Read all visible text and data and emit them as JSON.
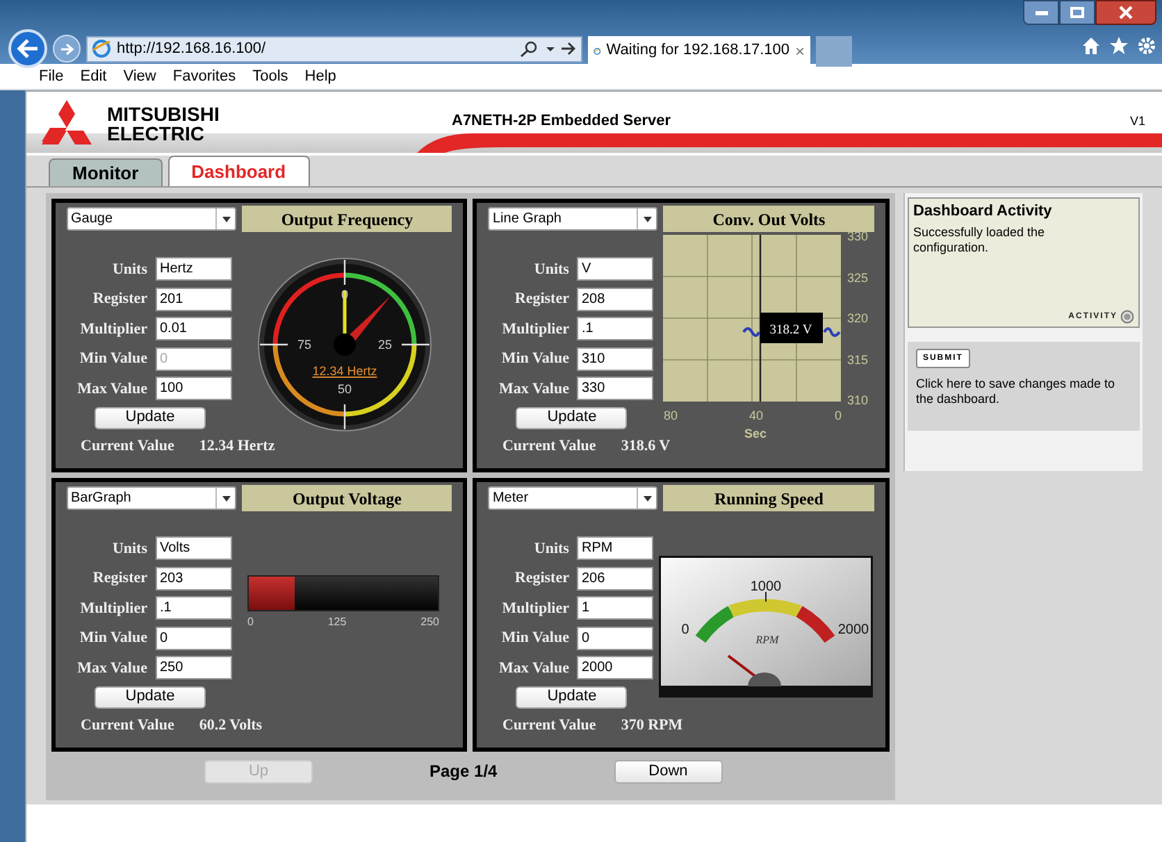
{
  "browser": {
    "address": "http://192.168.16.100/",
    "tab_title": "Waiting for 192.168.17.100",
    "tab_close": "×"
  },
  "menu": [
    "File",
    "Edit",
    "View",
    "Favorites",
    "Tools",
    "Help"
  ],
  "header": {
    "brand_line1": "MITSUBISHI",
    "brand_line2": "ELECTRIC",
    "title": "A7NETH-2P Embedded Server",
    "version": "V1"
  },
  "tabs": [
    {
      "label": "Monitor",
      "selected": false
    },
    {
      "label": "Dashboard",
      "selected": true
    }
  ],
  "widgets": [
    {
      "kind": "gauge",
      "display_type": "Gauge",
      "title": "Output Frequency",
      "fields": [
        {
          "label": "Units",
          "value": "Hertz",
          "disabled": false
        },
        {
          "label": "Register",
          "value": "201",
          "disabled": false
        },
        {
          "label": "Multiplier",
          "value": "0.01",
          "disabled": false
        },
        {
          "label": "Min Value",
          "value": "0",
          "disabled": true
        },
        {
          "label": "Max Value",
          "value": "100",
          "disabled": false
        }
      ],
      "update_button": "Update",
      "current_value_label": "Current Value",
      "current_value": "12.34 Hertz",
      "scale_labels": [
        "0",
        "25",
        "50",
        "75"
      ],
      "readout": "12.34 Hertz"
    },
    {
      "kind": "line",
      "display_type": "Line Graph",
      "title": "Conv. Out Volts",
      "fields": [
        {
          "label": "Units",
          "value": "V",
          "disabled": false
        },
        {
          "label": "Register",
          "value": "208",
          "disabled": false
        },
        {
          "label": "Multiplier",
          "value": ".1",
          "disabled": false
        },
        {
          "label": "Min Value",
          "value": "310",
          "disabled": false
        },
        {
          "label": "Max Value",
          "value": "330",
          "disabled": false
        }
      ],
      "update_button": "Update",
      "current_value_label": "Current Value",
      "current_value": "318.6 V",
      "y_ticks": [
        "330",
        "325",
        "320",
        "315",
        "310"
      ],
      "x_ticks": [
        "80",
        "40",
        "0"
      ],
      "x_label": "Sec",
      "tooltip": "318.2 V"
    },
    {
      "kind": "bar",
      "display_type": "BarGraph",
      "title": "Output Voltage",
      "fields": [
        {
          "label": "Units",
          "value": "Volts",
          "disabled": false
        },
        {
          "label": "Register",
          "value": "203",
          "disabled": false
        },
        {
          "label": "Multiplier",
          "value": ".1",
          "disabled": false
        },
        {
          "label": "Min Value",
          "value": "0",
          "disabled": false
        },
        {
          "label": "Max Value",
          "value": "250",
          "disabled": false
        }
      ],
      "update_button": "Update",
      "current_value_label": "Current Value",
      "current_value": "60.2 Volts",
      "scale_labels": [
        "0",
        "125",
        "250"
      ],
      "level": 0.24
    },
    {
      "kind": "meter",
      "display_type": "Meter",
      "title": "Running Speed",
      "fields": [
        {
          "label": "Units",
          "value": "RPM",
          "disabled": false
        },
        {
          "label": "Register",
          "value": "206",
          "disabled": false
        },
        {
          "label": "Multiplier",
          "value": "1",
          "disabled": false
        },
        {
          "label": "Min Value",
          "value": "0",
          "disabled": false
        },
        {
          "label": "Max Value",
          "value": "2000",
          "disabled": false
        }
      ],
      "update_button": "Update",
      "current_value_label": "Current Value",
      "current_value": "370 RPM",
      "scale_labels": [
        "0",
        "1000",
        "2000"
      ],
      "unit_label": "RPM"
    }
  ],
  "pager": {
    "up": {
      "label": "Up",
      "disabled": true
    },
    "page": "Page 1/4",
    "down": {
      "label": "Down",
      "disabled": false
    }
  },
  "activity": {
    "title": "Dashboard Activity",
    "message": "Successfully loaded the configuration.",
    "indicator_label": "ACTIVITY"
  },
  "submit": {
    "button": "SUBMIT",
    "hint": "Click here to save changes made to the dashboard."
  }
}
